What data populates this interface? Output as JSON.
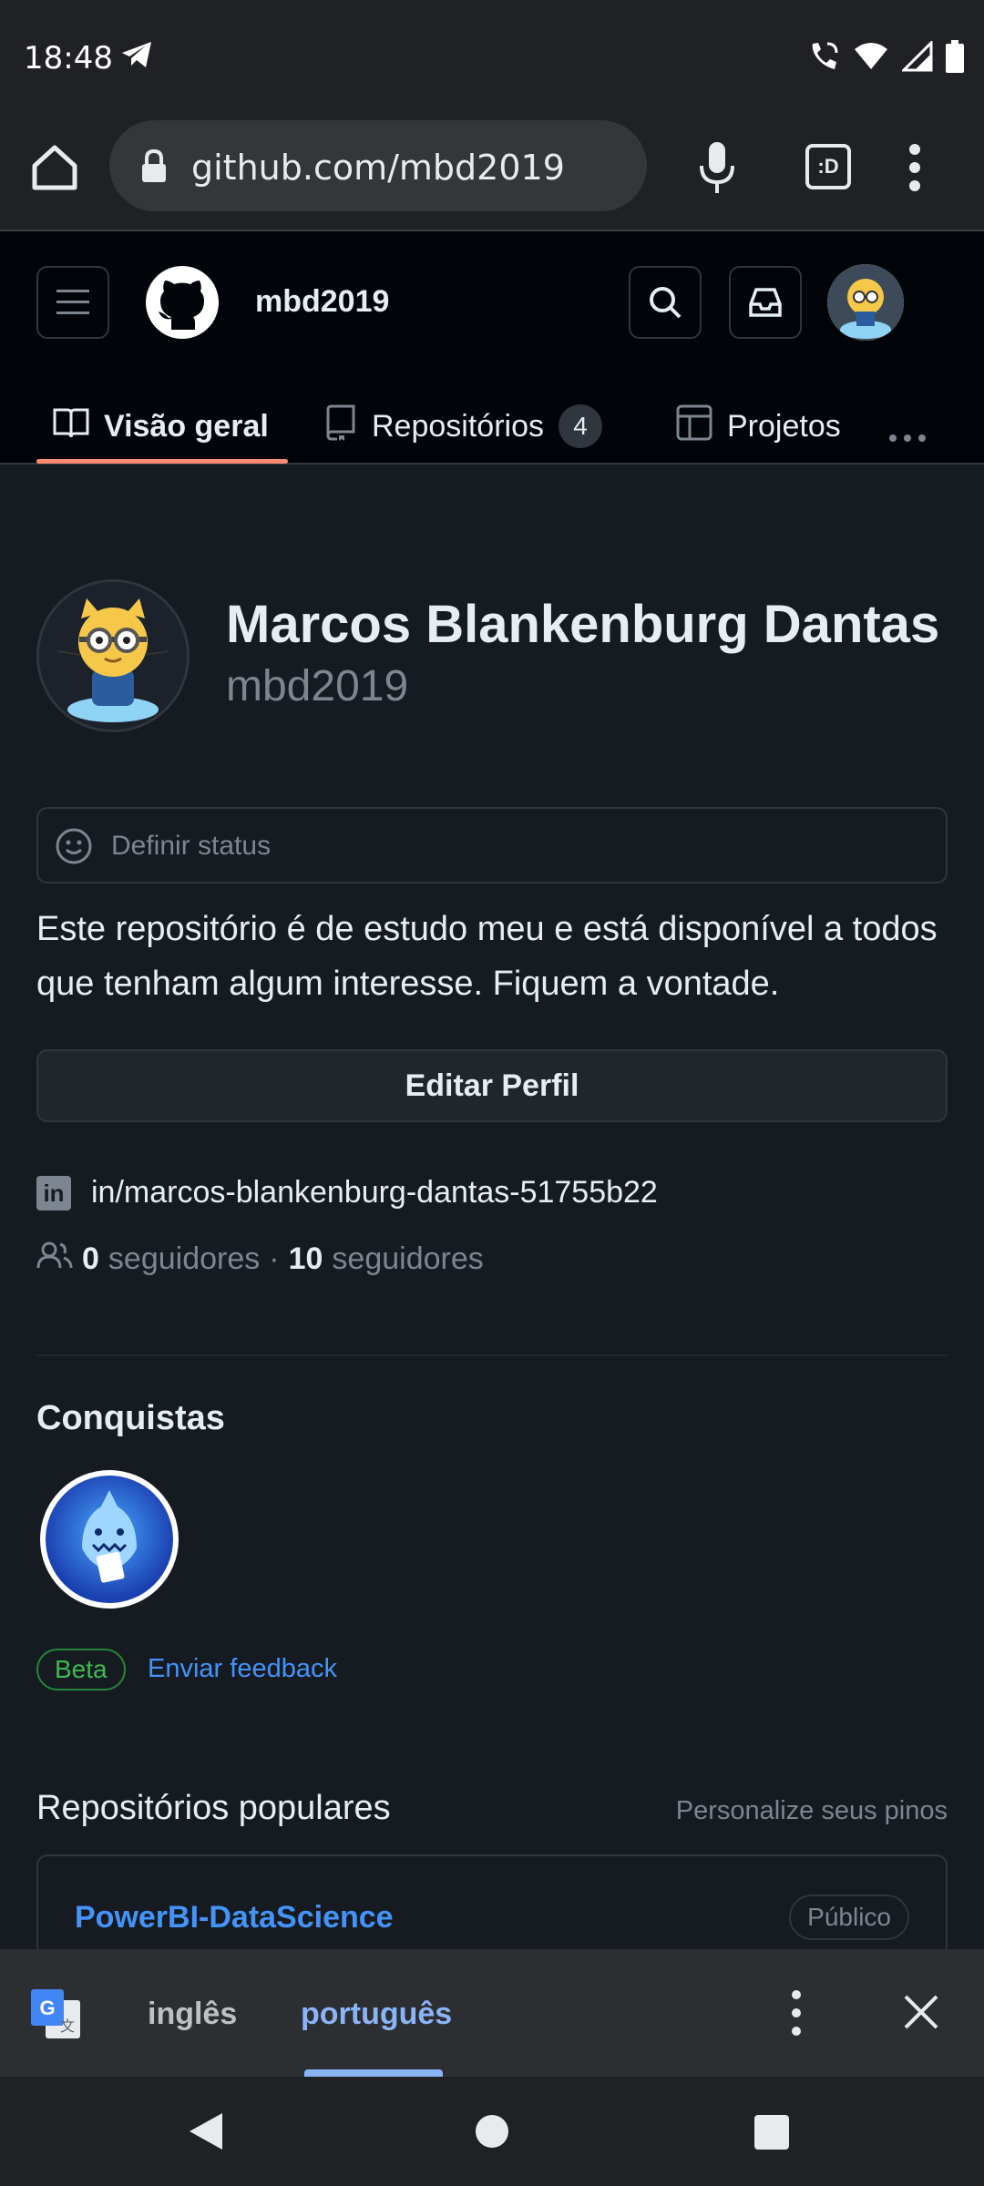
{
  "status_bar": {
    "time": "18:48"
  },
  "browser": {
    "url": "github.com/mbd2019",
    "tabs_label": ":D"
  },
  "header": {
    "username": "mbd2019"
  },
  "nav": {
    "tabs": [
      {
        "label": "Visão geral"
      },
      {
        "label": "Repositórios",
        "count": "4"
      },
      {
        "label": "Projetos"
      }
    ]
  },
  "profile": {
    "name": "Marcos Blankenburg Dantas",
    "login": "mbd2019",
    "status_placeholder": "Definir status",
    "bio": "Este repositório é de estudo meu e está disponível a todos que tenham algum interesse. Fiquem a vontade.",
    "edit_button": "Editar Perfil",
    "linkedin": "in/marcos-blankenburg-dantas-51755b22",
    "followers_count": "0",
    "followers_label": "seguidores",
    "separator": "·",
    "following_count": "10",
    "following_label": "seguidores"
  },
  "achievements": {
    "title": "Conquistas",
    "beta_label": "Beta",
    "feedback_label": "Enviar feedback"
  },
  "popular": {
    "title": "Repositórios populares",
    "customize_label": "Personalize seus pinos",
    "repos": [
      {
        "name": "PowerBI-DataScience",
        "visibility": "Público"
      }
    ]
  },
  "translate": {
    "source": "inglês",
    "target": "português"
  },
  "colors": {
    "accent": "#fd8c73",
    "link": "#4493f8",
    "bg": "#161b22",
    "header_bg": "#010409"
  }
}
